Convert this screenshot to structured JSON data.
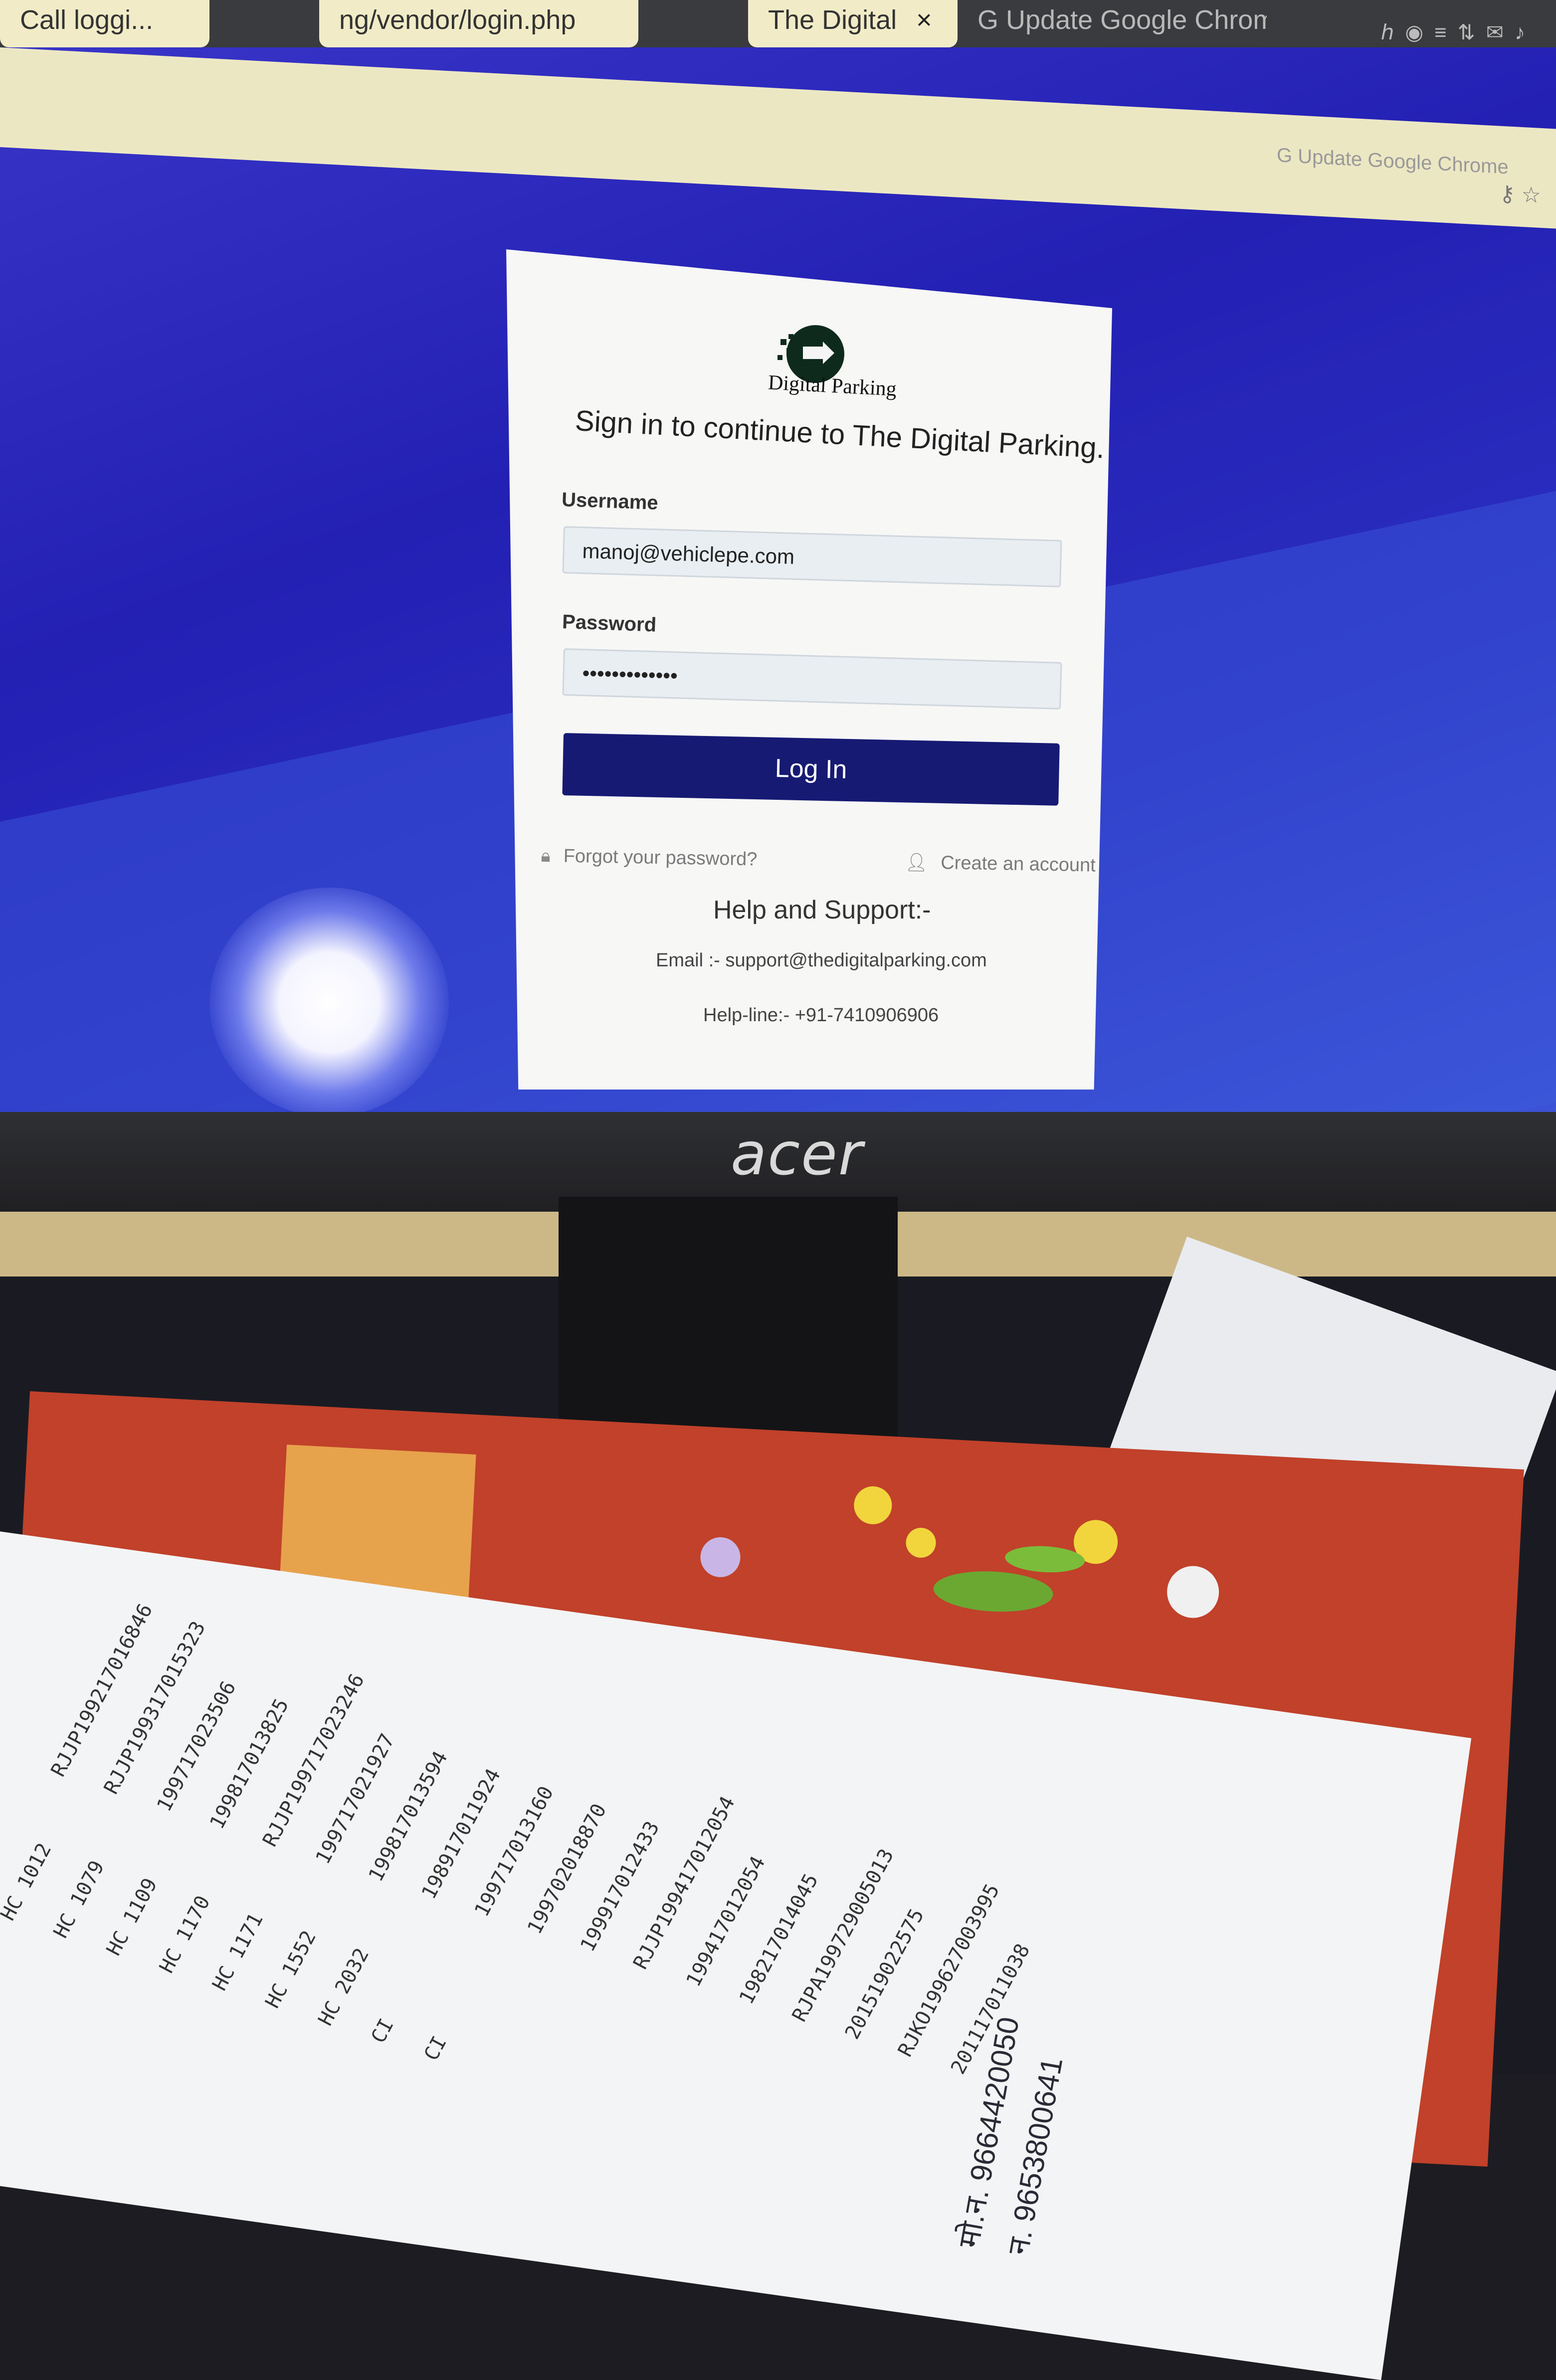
{
  "browser": {
    "tabs": [
      {
        "label": "Call loggi...",
        "active": false
      },
      {
        "label": "ng/vendor/login.php",
        "active": false
      },
      {
        "label": "The Digital",
        "active": true
      },
      {
        "label": "Update Google Chrome",
        "active": false
      },
      {
        "label": "Update Google Chrome",
        "active": false
      }
    ],
    "close_glyph": "×"
  },
  "login": {
    "logo_text": "Digital Parking",
    "title": "Sign in to continue to The Digital Parking.",
    "username_label": "Username",
    "username_value": "manoj@vehiclepe.com",
    "password_label": "Password",
    "password_value": "•••••••••••••",
    "login_button": "Log In",
    "forgot_password": "Forgot your password?",
    "create_account": "Create an account",
    "help_title": "Help and Support:-",
    "help_email": "Email :- support@thedigitalparking.com",
    "help_phone": "Help-line:- +91-7410906906",
    "button_color": "#161a73"
  },
  "monitor": {
    "brand": "acer"
  },
  "desk_paper": {
    "phone_1": "मो.न. 9664420050",
    "phone_2": "न. 9653800641",
    "row_codes": [
      "HC 1012",
      "HC 1079",
      "HC 1109",
      "HC 1170",
      "HC 1171",
      "HC 1552",
      "HC 2032",
      "CI",
      "CI"
    ],
    "row_numbers": [
      "RJJP199217016846",
      "RJJP199317015323",
      "199717023506",
      "199817013825",
      "RJJP199717023246",
      "199717021927",
      "199817013594",
      "198917011924",
      "199717013160",
      "199702018870",
      "199917012433",
      "RJJP199417012054",
      "199417012054",
      "198217014045",
      "RJPA199729005013",
      "201519022575",
      "RJKO199627003995",
      "201117011038"
    ]
  }
}
